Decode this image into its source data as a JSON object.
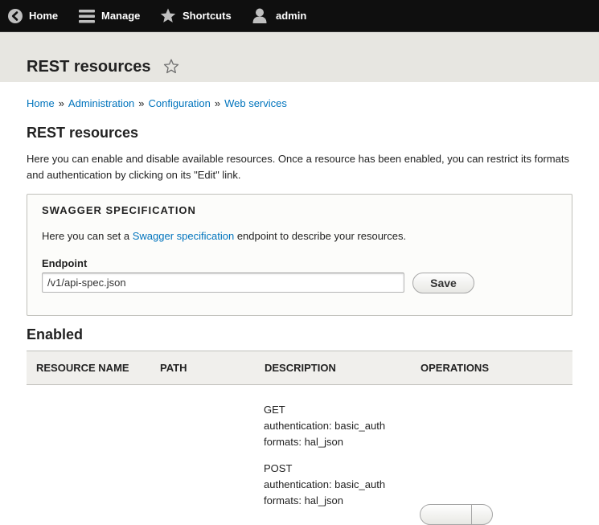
{
  "toolbar": {
    "home_label": "Home",
    "manage_label": "Manage",
    "shortcuts_label": "Shortcuts",
    "user_label": "admin",
    "icons": [
      "back-arrow-icon",
      "hamburger-menu-icon",
      "star-icon",
      "user-icon"
    ]
  },
  "page": {
    "title": "REST resources"
  },
  "breadcrumb": {
    "items": [
      "Home",
      "Administration",
      "Configuration",
      "Web services"
    ],
    "separator": "»"
  },
  "content": {
    "heading": "REST resources",
    "description": "Here you can enable and disable available resources. Once a resource has been enabled, you can restrict its formats and authentication by clicking on its \"Edit\" link."
  },
  "swagger": {
    "legend": "SWAGGER SPECIFICATION",
    "text_before": "Here you can set a ",
    "link_text": "Swagger specification",
    "text_after": " endpoint to describe your resources.",
    "endpoint_label": "Endpoint",
    "endpoint_value": "/v1/api-spec.json",
    "save_label": "Save"
  },
  "enabled": {
    "heading": "Enabled",
    "columns": [
      "RESOURCE NAME",
      "PATH",
      "DESCRIPTION",
      "OPERATIONS"
    ],
    "operations": [
      {
        "method": "GET",
        "authentication": "authentication: basic_auth",
        "formats": "formats: hal_json"
      },
      {
        "method": "POST",
        "authentication": "authentication: basic_auth",
        "formats": "formats: hal_json"
      }
    ]
  },
  "colors": {
    "toolbar_bg": "#0f0f0f",
    "header_bg": "#e7e6e1",
    "link": "#0074bd",
    "table_header_bg": "#f0efec"
  }
}
